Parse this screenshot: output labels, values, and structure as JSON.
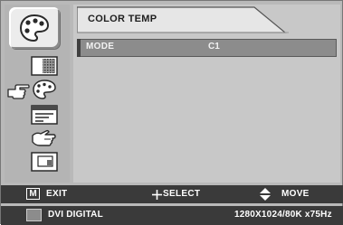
{
  "osd": {
    "active_menu_icon": "palette-icon",
    "side_icons": [
      "picture-icon",
      "palette-icon",
      "image-settings-icon",
      "hand-position-icon",
      "screen-icon"
    ],
    "selected_side_icon": "palette-icon",
    "pointer_icon": "pointing-hand-icon"
  },
  "menu": {
    "title": "COLOR TEMP",
    "row": {
      "label": "MODE",
      "value": "C1"
    }
  },
  "help": {
    "exit_key": "M",
    "exit_label": "EXIT",
    "select_label": "SELECT",
    "move_label": "MOVE"
  },
  "status": {
    "input": "DVI DIGITAL",
    "resolution": "1280X1024/80K x75Hz"
  },
  "colors": {
    "panel": "#b9b9b9",
    "bar": "#3a3a3a",
    "row_highlight": "#8c8c8c"
  }
}
